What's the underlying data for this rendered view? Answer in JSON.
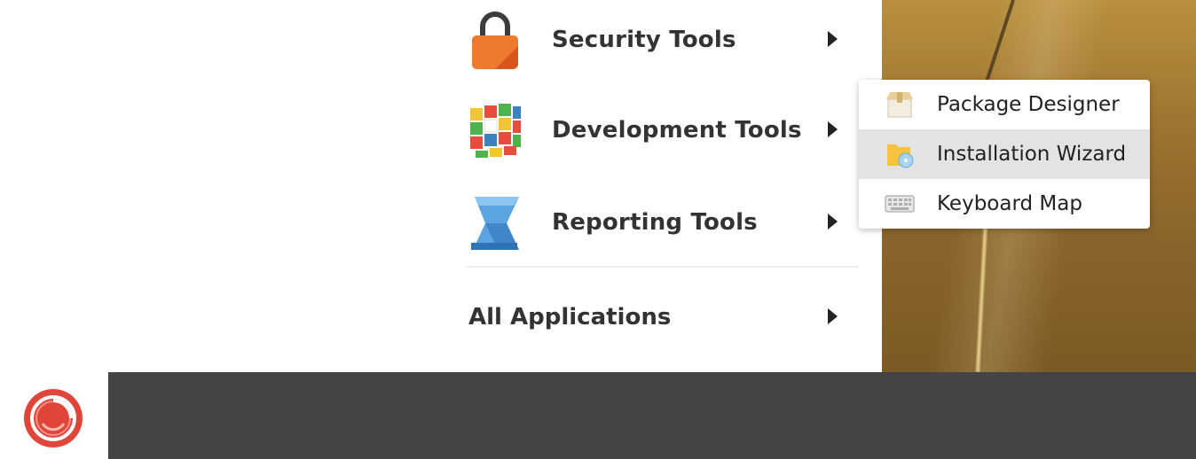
{
  "menu": {
    "items": [
      {
        "label": "Security Tools",
        "icon": "lock-icon"
      },
      {
        "label": "Development Tools",
        "icon": "rubiks-cube-icon"
      },
      {
        "label": "Reporting Tools",
        "icon": "report-scroll-icon"
      }
    ],
    "all_applications": "All Applications"
  },
  "submenu": {
    "items": [
      {
        "label": "Package Designer",
        "icon": "package-icon"
      },
      {
        "label": "Installation Wizard",
        "icon": "install-folder-icon"
      },
      {
        "label": "Keyboard Map",
        "icon": "keyboard-icon"
      }
    ],
    "highlighted_index": 1
  },
  "taskbar": {
    "start_icon": "sitecore-logo-icon"
  },
  "colors": {
    "taskbar": "#444444",
    "highlight": "#e3e3e3",
    "accent": "#e0453a",
    "lock": "#ee7b2d"
  }
}
